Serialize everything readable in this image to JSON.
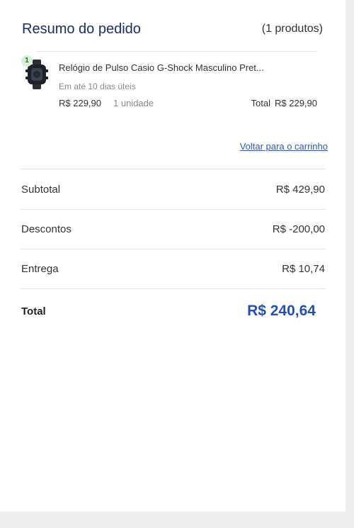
{
  "summary": {
    "title": "Resumo do pedido",
    "product_count": "(1 produtos)"
  },
  "product": {
    "qty_badge": "1",
    "name": "Relógio de Pulso Casio G-Shock Masculino Pret...",
    "delivery": "Em até 10 dias úteis",
    "unit_price": "R$ 229,90",
    "quantity": "1 unidade",
    "total_label": "Total",
    "total_value": "R$ 229,90",
    "icon": "watch-icon"
  },
  "back_link": "Voltar para o carrinho",
  "totals": {
    "subtotal_label": "Subtotal",
    "subtotal_value": "R$ 429,90",
    "discount_label": "Descontos",
    "discount_value": "R$ -200,00",
    "shipping_label": "Entrega",
    "shipping_value": "R$ 10,74",
    "total_label": "Total",
    "total_value": "R$ 240,64"
  },
  "colors": {
    "title": "#1c2d6b",
    "total_accent": "#2550b0",
    "link": "#2a5bb5"
  }
}
